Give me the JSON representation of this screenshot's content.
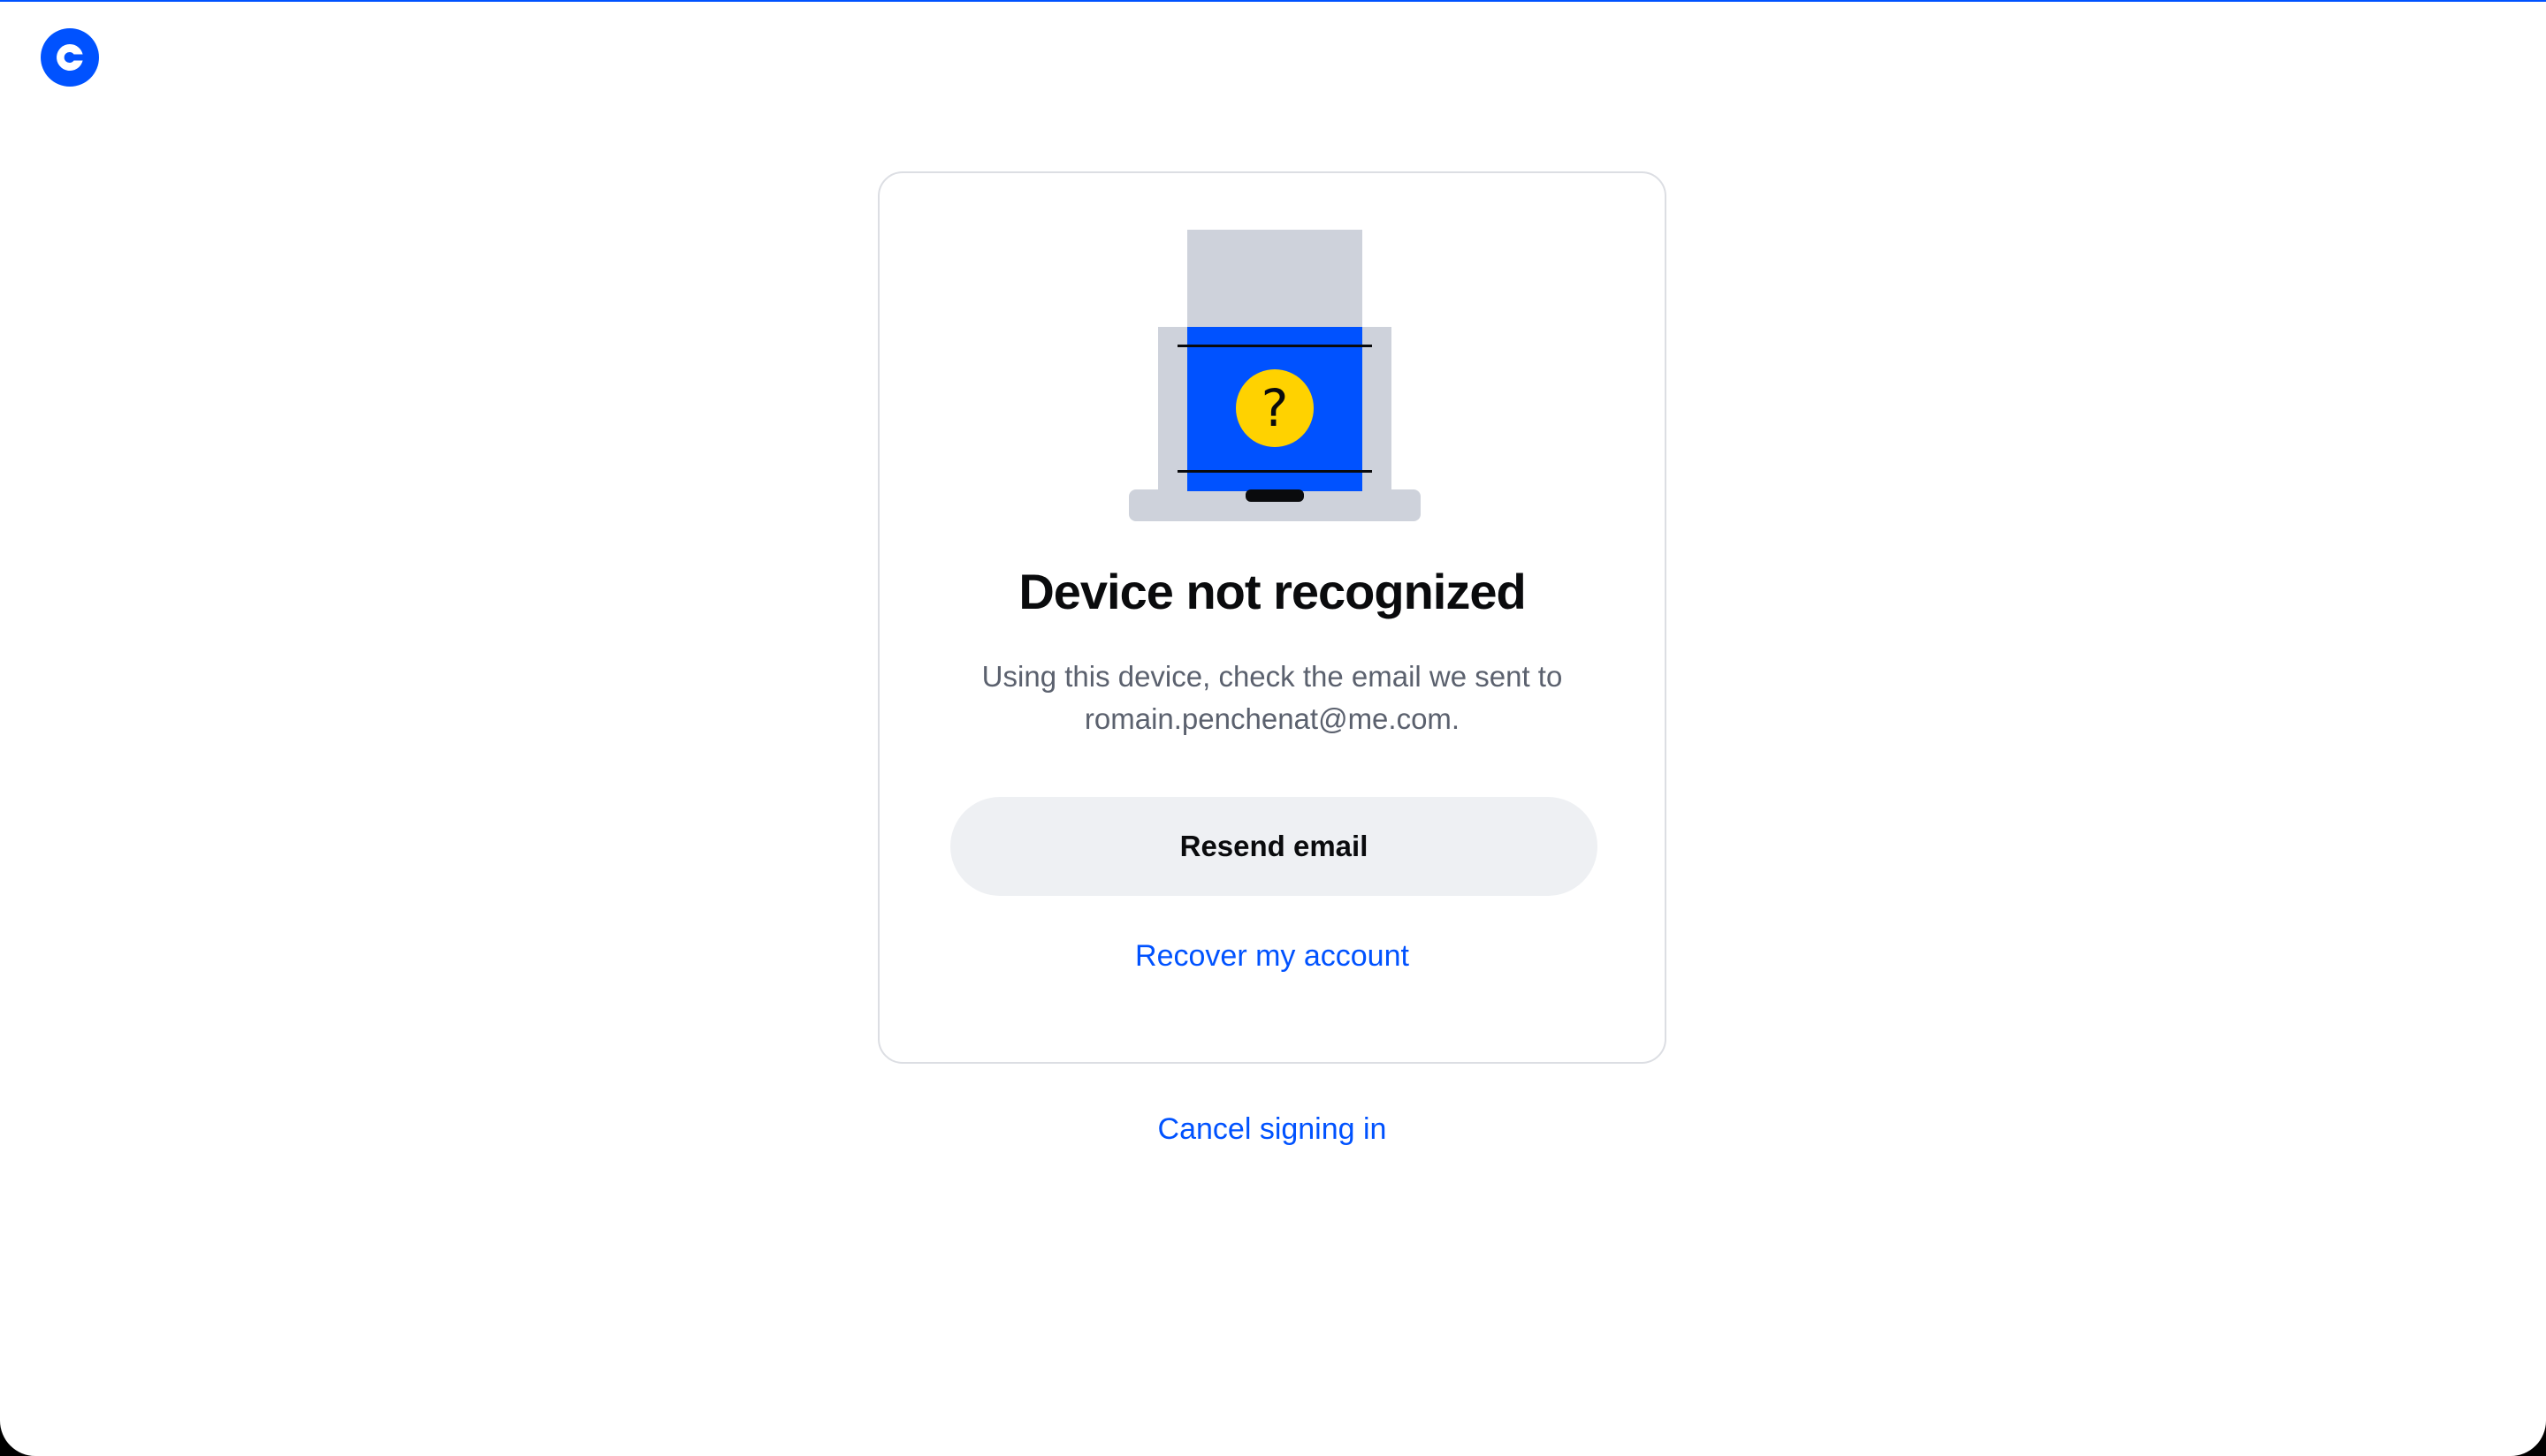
{
  "colors": {
    "brand": "#0052ff",
    "title": "#0a0b0d",
    "body_text": "#5b616e",
    "button_bg": "#eef0f3",
    "card_border": "#dcdee3",
    "illustration_gray": "#ced2db",
    "illustration_yellow": "#ffd200"
  },
  "header": {
    "logo_icon": "coinbase-logo-icon"
  },
  "card": {
    "illustration_icon": "laptop-question-icon",
    "title": "Device not recognized",
    "description_line1": "Using this device, check the email we sent to",
    "description_line2": "romain.penchenat@me.com.",
    "resend_label": "Resend email",
    "recover_label": "Recover my account"
  },
  "footer": {
    "cancel_label": "Cancel signing in"
  }
}
